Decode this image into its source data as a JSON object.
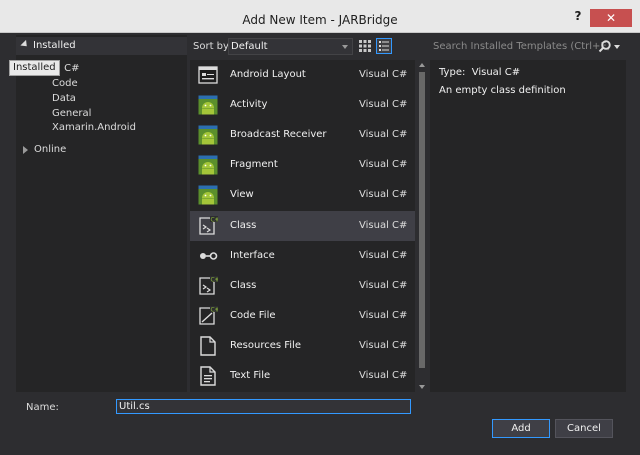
{
  "window": {
    "title": "Add New Item - JARBridge",
    "help_label": "?",
    "close_label": "✕"
  },
  "tree": {
    "root_label": "Installed",
    "tooltip": "Installed",
    "visual_csharp_partial": "al C#",
    "items": [
      "Code",
      "Data",
      "General",
      "Xamarin.Android"
    ],
    "online_label": "Online"
  },
  "toolbar": {
    "sort_label": "Sort by:",
    "sort_value": "Default"
  },
  "search": {
    "placeholder": "Search Installed Templates (Ctrl+E)"
  },
  "templates": [
    {
      "name": "Android Layout",
      "lang": "Visual C#",
      "icon": "layout-icon"
    },
    {
      "name": "Activity",
      "lang": "Visual C#",
      "icon": "android-icon"
    },
    {
      "name": "Broadcast Receiver",
      "lang": "Visual C#",
      "icon": "android-icon"
    },
    {
      "name": "Fragment",
      "lang": "Visual C#",
      "icon": "android-icon"
    },
    {
      "name": "View",
      "lang": "Visual C#",
      "icon": "android-icon"
    },
    {
      "name": "Class",
      "lang": "Visual C#",
      "icon": "csharp-class-icon"
    },
    {
      "name": "Interface",
      "lang": "Visual C#",
      "icon": "interface-icon"
    },
    {
      "name": "Class",
      "lang": "Visual C#",
      "icon": "csharp-class-icon"
    },
    {
      "name": "Code File",
      "lang": "Visual C#",
      "icon": "code-file-icon"
    },
    {
      "name": "Resources File",
      "lang": "Visual C#",
      "icon": "resources-file-icon"
    },
    {
      "name": "Text File",
      "lang": "Visual C#",
      "icon": "text-file-icon"
    }
  ],
  "selected_index": 5,
  "details": {
    "type_label": "Type:",
    "type_value": "Visual C#",
    "description": "An empty class definition"
  },
  "bottom": {
    "name_label": "Name:",
    "name_value": "Util.cs",
    "add_label": "Add",
    "cancel_label": "Cancel"
  },
  "colors": {
    "accent": "#3399ff",
    "close": "#c75050",
    "android_green": "#8ab43a",
    "android_blue": "#2c6fb0"
  }
}
